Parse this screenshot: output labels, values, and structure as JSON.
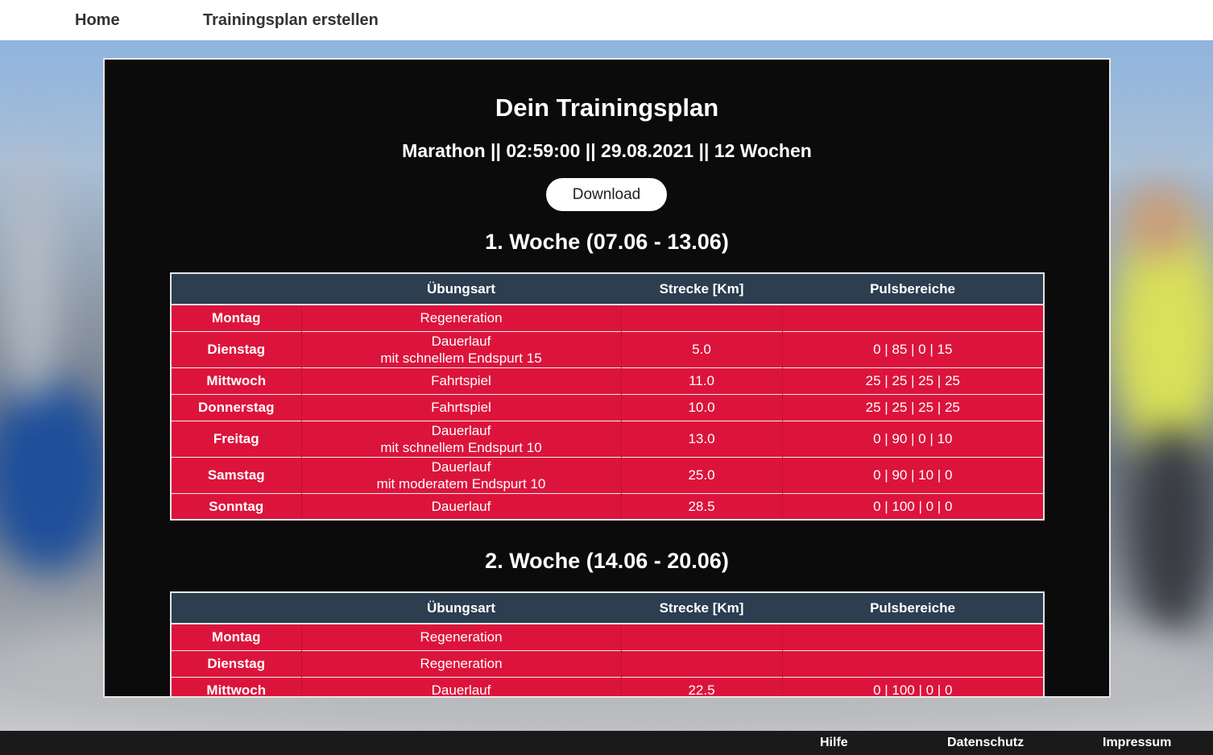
{
  "nav": {
    "home": "Home",
    "create_plan": "Trainingsplan erstellen"
  },
  "page": {
    "title": "Dein Trainingsplan",
    "subtitle": "Marathon || 02:59:00 || 29.08.2021 || 12 Wochen",
    "download_label": "Download"
  },
  "table_headers": {
    "day": "",
    "exercise": "Übungsart",
    "distance": "Strecke [Km]",
    "pulse": "Pulsbereiche"
  },
  "weeks": [
    {
      "title": "1. Woche (07.06 - 13.06)",
      "rows": [
        {
          "day": "Montag",
          "exercise": "Regeneration",
          "distance": "",
          "pulse": ""
        },
        {
          "day": "Dienstag",
          "exercise": "Dauerlauf\nmit schnellem Endspurt 15",
          "distance": "5.0",
          "pulse": "0 | 85 | 0 | 15"
        },
        {
          "day": "Mittwoch",
          "exercise": "Fahrtspiel",
          "distance": "11.0",
          "pulse": "25 | 25 | 25 | 25"
        },
        {
          "day": "Donnerstag",
          "exercise": "Fahrtspiel",
          "distance": "10.0",
          "pulse": "25 | 25 | 25 | 25"
        },
        {
          "day": "Freitag",
          "exercise": "Dauerlauf\nmit schnellem Endspurt 10",
          "distance": "13.0",
          "pulse": "0 | 90 | 0 | 10"
        },
        {
          "day": "Samstag",
          "exercise": "Dauerlauf\nmit moderatem Endspurt 10",
          "distance": "25.0",
          "pulse": "0 | 90 | 10 | 0"
        },
        {
          "day": "Sonntag",
          "exercise": "Dauerlauf",
          "distance": "28.5",
          "pulse": "0 | 100 | 0 | 0"
        }
      ]
    },
    {
      "title": "2. Woche (14.06 - 20.06)",
      "rows": [
        {
          "day": "Montag",
          "exercise": "Regeneration",
          "distance": "",
          "pulse": ""
        },
        {
          "day": "Dienstag",
          "exercise": "Regeneration",
          "distance": "",
          "pulse": ""
        },
        {
          "day": "Mittwoch",
          "exercise": "Dauerlauf",
          "distance": "22.5",
          "pulse": "0 | 100 | 0 | 0"
        }
      ]
    }
  ],
  "footer": {
    "help": "Hilfe",
    "privacy": "Datenschutz",
    "imprint": "Impressum"
  },
  "colors": {
    "header_row": "#2c3e50",
    "data_row": "#dc143c",
    "panel": "#0b0b0c",
    "footer": "#1a1a1a"
  }
}
